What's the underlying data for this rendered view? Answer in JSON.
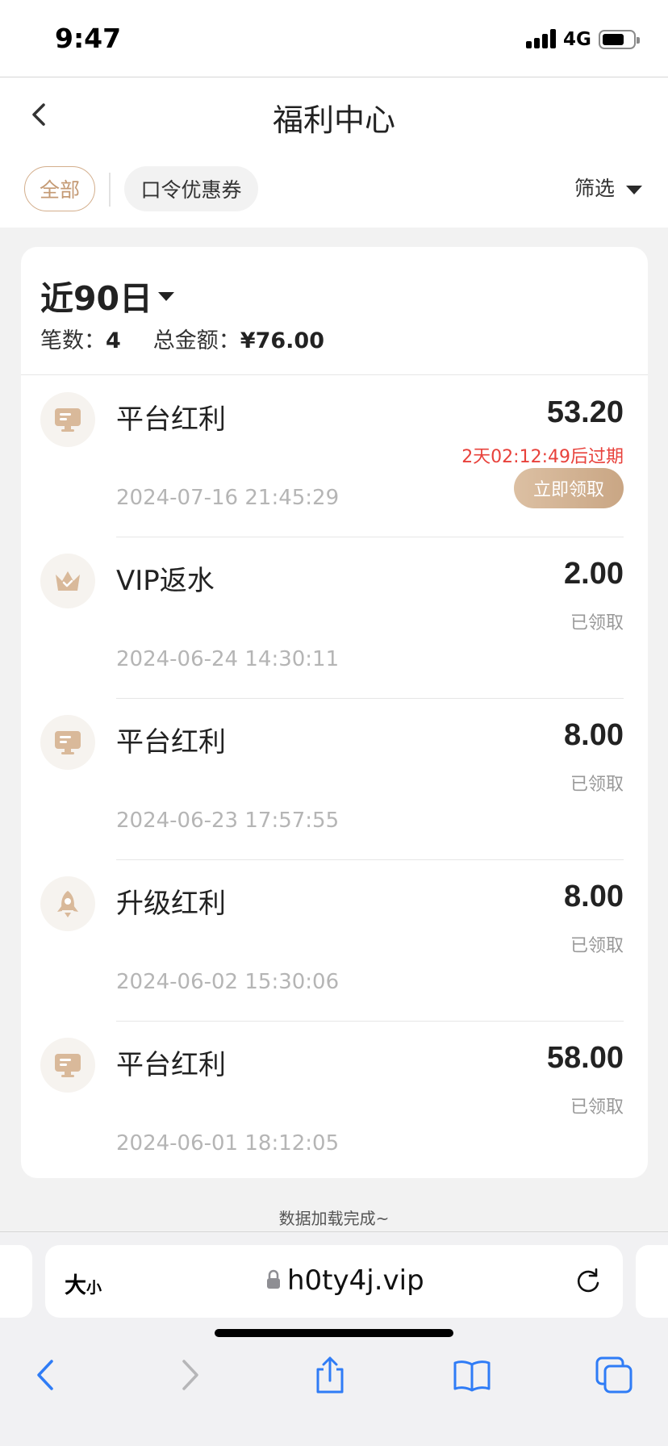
{
  "status_bar": {
    "time": "9:47",
    "network": "4G"
  },
  "header": {
    "title": "福利中心",
    "tabs": [
      {
        "label": "全部"
      },
      {
        "label": "口令优惠券"
      }
    ],
    "filter_label": "筛选"
  },
  "summary": {
    "period": "近90日",
    "count_label": "笔数：",
    "count_value": "4",
    "total_label": "总金额：",
    "total_value": "¥76.00"
  },
  "records": [
    {
      "title": "平台红利",
      "amount": "53.20",
      "date": "2024-07-16 21:45:29",
      "expire": "2天02:12:49后过期",
      "action": "立即领取",
      "icon": "monitor-icon"
    },
    {
      "title": "VIP返水",
      "amount": "2.00",
      "status": "已领取",
      "date": "2024-06-24 14:30:11",
      "icon": "crown-icon"
    },
    {
      "title": "平台红利",
      "amount": "8.00",
      "status": "已领取",
      "date": "2024-06-23 17:57:55",
      "icon": "monitor-icon"
    },
    {
      "title": "升级红利",
      "amount": "8.00",
      "status": "已领取",
      "date": "2024-06-02 15:30:06",
      "icon": "rocket-icon"
    },
    {
      "title": "平台红利",
      "amount": "58.00",
      "status": "已领取",
      "date": "2024-06-01 18:12:05",
      "icon": "monitor-icon"
    }
  ],
  "footer": {
    "loaded_text": "数据加载完成~"
  },
  "browser": {
    "text_size_label": "大",
    "text_size_small": "小",
    "url": "h0ty4j.vip"
  },
  "colors": {
    "accent": "#c9a684",
    "expire": "#e8413b",
    "link_blue": "#2f7cf6"
  }
}
